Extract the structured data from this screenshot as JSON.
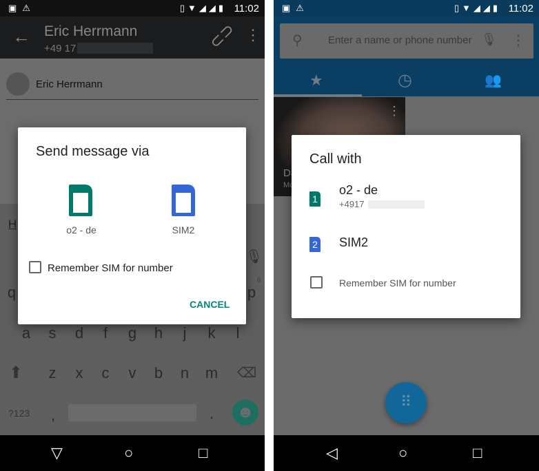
{
  "status": {
    "time": "11:02"
  },
  "left": {
    "toolbar": {
      "title": "Eric Herrmann",
      "subtitle": "+49 17"
    },
    "recipient": "Eric Herrmann",
    "compose_partial": "H",
    "keyboard": {
      "row1": [
        "q",
        "p"
      ],
      "row1_hint": "0",
      "row2": [
        "a",
        "s",
        "d",
        "f",
        "g",
        "h",
        "j",
        "k",
        "l"
      ],
      "row3": [
        "z",
        "x",
        "c",
        "v",
        "b",
        "n",
        "m"
      ],
      "symbols": "?123",
      "comma": ",",
      "period": "."
    },
    "dialog": {
      "title": "Send message via",
      "sims": [
        {
          "label": "o2 - de",
          "color": "#00796b"
        },
        {
          "label": "SIM2",
          "color": "#3367d6"
        }
      ],
      "remember": "Remember SIM for number",
      "cancel": "CANCEL",
      "accent": "#00897b"
    }
  },
  "right": {
    "search": {
      "placeholder": "Enter a name or phone number"
    },
    "tabs": [
      "favorites",
      "recents",
      "contacts"
    ],
    "tile": {
      "name_partial": "Da",
      "sub_partial": "Mo"
    },
    "dialog": {
      "title": "Call with",
      "sims": [
        {
          "num": "1",
          "label": "o2 - de",
          "number": "+4917",
          "color": "#00796b"
        },
        {
          "num": "2",
          "label": "SIM2",
          "color": "#3367d6"
        }
      ],
      "remember": "Remember SIM for number"
    },
    "fab": "dialpad-icon"
  }
}
